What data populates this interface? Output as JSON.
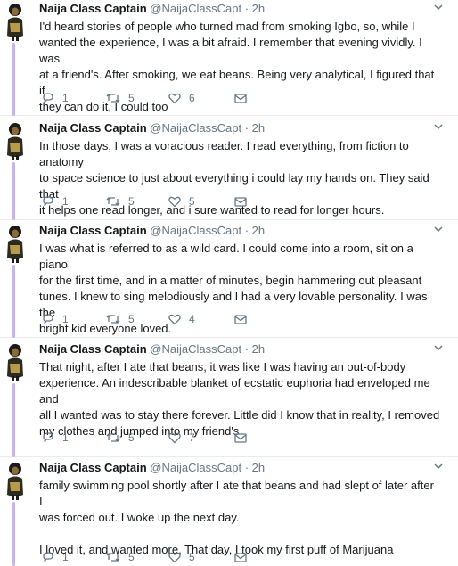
{
  "tweets": [
    {
      "name": "Naija Class Captain",
      "handle": "@NaijaClassCapt",
      "dot": "·",
      "time": "2h",
      "text": "I'd heard stories of people who turned mad from smoking Igbo, so, while I\nwanted the experience, I was a bit afraid. I remember that evening vividly. I was\nat a friend's. After smoking, we eat beans. Being very analytical, I figured that if\nthey can do it, I could too",
      "replies": "1",
      "retweets": "5",
      "likes": "6"
    },
    {
      "name": "Naija Class Captain",
      "handle": "@NaijaClassCapt",
      "dot": "·",
      "time": "2h",
      "text": "In those days, I was a voracious reader. I read everything, from fiction to anatomy\nto space science to just about everything i could lay my hands on. They said that\nit helps one read longer, and i sure wanted to read for longer hours.",
      "replies": "1",
      "retweets": "5",
      "likes": "5"
    },
    {
      "name": "Naija Class Captain",
      "handle": "@NaijaClassCapt",
      "dot": "·",
      "time": "2h",
      "text": "I was what is referred to as a wild card. I could come into a room, sit on a piano\nfor the first time, and in a matter of minutes, begin hammering out pleasant\ntunes. I knew to sing melodiously and I had a very lovable personality. I was the\nbright kid everyone loved.",
      "replies": "1",
      "retweets": "5",
      "likes": "4"
    },
    {
      "name": "Naija Class Captain",
      "handle": "@NaijaClassCapt",
      "dot": "·",
      "time": "2h",
      "text": "That night, after I ate that beans, it was like I was having an out-of-body\nexperience. An indescribable blanket of ecstatic euphoria had enveloped me and\nall I wanted was to stay there forever. Little did I know that in reality, I removed\nmy clothes and jumped into my friend's",
      "replies": "1",
      "retweets": "5",
      "likes": "7"
    },
    {
      "name": "Naija Class Captain",
      "handle": "@NaijaClassCapt",
      "dot": "·",
      "time": "2h",
      "text": "family swimming pool shortly after I ate that beans and had slept of later after I\nwas forced out. I woke up the next day.\n\nI loved it, and wanted more. That day, I took my first puff of Marijuana",
      "replies": "1",
      "retweets": "5",
      "likes": "5"
    }
  ],
  "icons": {
    "reply": "reply-icon",
    "retweet": "retweet-icon",
    "like": "heart-icon",
    "dm": "envelope-icon",
    "caret": "chevron-down-icon"
  },
  "colors": {
    "text": "#14171a",
    "muted": "#657786",
    "thread_line": "#c4b5f0",
    "divider": "#e6ecf0"
  }
}
